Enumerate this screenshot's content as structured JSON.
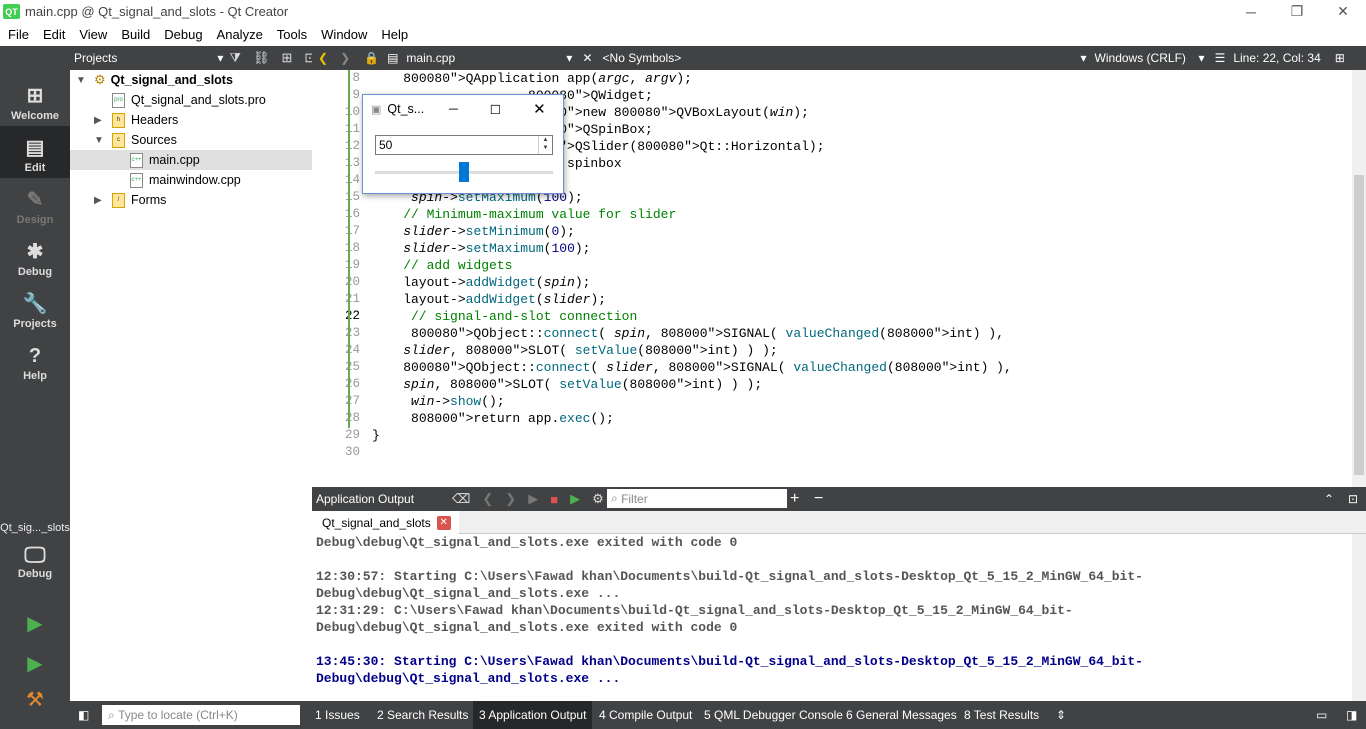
{
  "window": {
    "title": "main.cpp @ Qt_signal_and_slots - Qt Creator",
    "logo": "QT"
  },
  "menu": [
    "File",
    "Edit",
    "View",
    "Build",
    "Debug",
    "Analyze",
    "Tools",
    "Window",
    "Help"
  ],
  "modes": [
    {
      "label": "Welcome",
      "icon": "⊞"
    },
    {
      "label": "Edit",
      "icon": "▤"
    },
    {
      "label": "Design",
      "icon": "✎"
    },
    {
      "label": "Debug",
      "icon": "✱"
    },
    {
      "label": "Projects",
      "icon": "🔧"
    },
    {
      "label": "Help",
      "icon": "?"
    }
  ],
  "kit": {
    "project_label": "Qt_sig..._slots",
    "mode_label": "Debug"
  },
  "sidebar": {
    "title": "Projects",
    "tree": [
      {
        "label": "Qt_signal_and_slots"
      },
      {
        "label": "Qt_signal_and_slots.pro"
      },
      {
        "label": "Headers"
      },
      {
        "label": "Sources"
      },
      {
        "label": "main.cpp"
      },
      {
        "label": "mainwindow.cpp"
      },
      {
        "label": "Forms"
      }
    ]
  },
  "editor": {
    "file": "main.cpp",
    "symbols": "<No Symbols>",
    "line_ending": "Windows (CRLF)",
    "position": "Line: 22, Col: 34",
    "line_numbers": [
      "8",
      "9",
      "10",
      "11",
      "12",
      "13",
      "14",
      "15",
      "16",
      "17",
      "18",
      "19",
      "20",
      "21",
      "22",
      "23",
      "24",
      "25",
      "26",
      "27",
      "28",
      "29",
      "30"
    ],
    "lines": [
      "    QApplication app(argc, argv);",
      "                    QWidget;",
      "                   new QVBoxLayout(win);",
      "                   QSpinBox;",
      "                  QSlider(Qt::Horizontal);",
      "                 lue for spinbox",
      "",
      "     spin->setMaximum(100);",
      "    // Minimum-maximum value for slider",
      "    slider->setMinimum(0);",
      "    slider->setMaximum(100);",
      "    // add widgets",
      "    layout->addWidget(spin);",
      "    layout->addWidget(slider);",
      "     // signal-and-slot connection",
      "     QObject::connect( spin, SIGNAL( valueChanged(int) ),",
      "    slider, SLOT( setValue(int) ) );",
      "    QObject::connect( slider, SIGNAL( valueChanged(int) ),",
      "    spin, SLOT( setValue(int) ) );",
      "     win->show();",
      "     return app.exec();",
      "}",
      ""
    ]
  },
  "popup": {
    "title": "Qt_s...",
    "spin_value": "50",
    "slider_value": 50,
    "slider_max": 100
  },
  "output": {
    "title": "Application Output",
    "filter_placeholder": "Filter",
    "tab": "Qt_signal_and_slots",
    "lines": [
      "Debug\\debug\\Qt_signal_and_slots.exe exited with code 0",
      "",
      "12:30:57: Starting C:\\Users\\Fawad khan\\Documents\\build-Qt_signal_and_slots-Desktop_Qt_5_15_2_MinGW_64_bit-",
      "Debug\\debug\\Qt_signal_and_slots.exe ...",
      "12:31:29: C:\\Users\\Fawad khan\\Documents\\build-Qt_signal_and_slots-Desktop_Qt_5_15_2_MinGW_64_bit-",
      "Debug\\debug\\Qt_signal_and_slots.exe exited with code 0",
      "",
      "13:45:30: Starting C:\\Users\\Fawad khan\\Documents\\build-Qt_signal_and_slots-Desktop_Qt_5_15_2_MinGW_64_bit-",
      "Debug\\debug\\Qt_signal_and_slots.exe ..."
    ]
  },
  "statusbar": {
    "locator_placeholder": "Type to locate (Ctrl+K)",
    "tabs": [
      "1  Issues",
      "2  Search Results",
      "3  Application Output",
      "4  Compile Output",
      "5  QML Debugger Console",
      "6  General Messages",
      "8  Test Results"
    ]
  },
  "colors": {
    "dark": "#404244",
    "accent": "#0078d7",
    "keyword": "#808000",
    "type": "#800080",
    "comment": "#008000"
  }
}
